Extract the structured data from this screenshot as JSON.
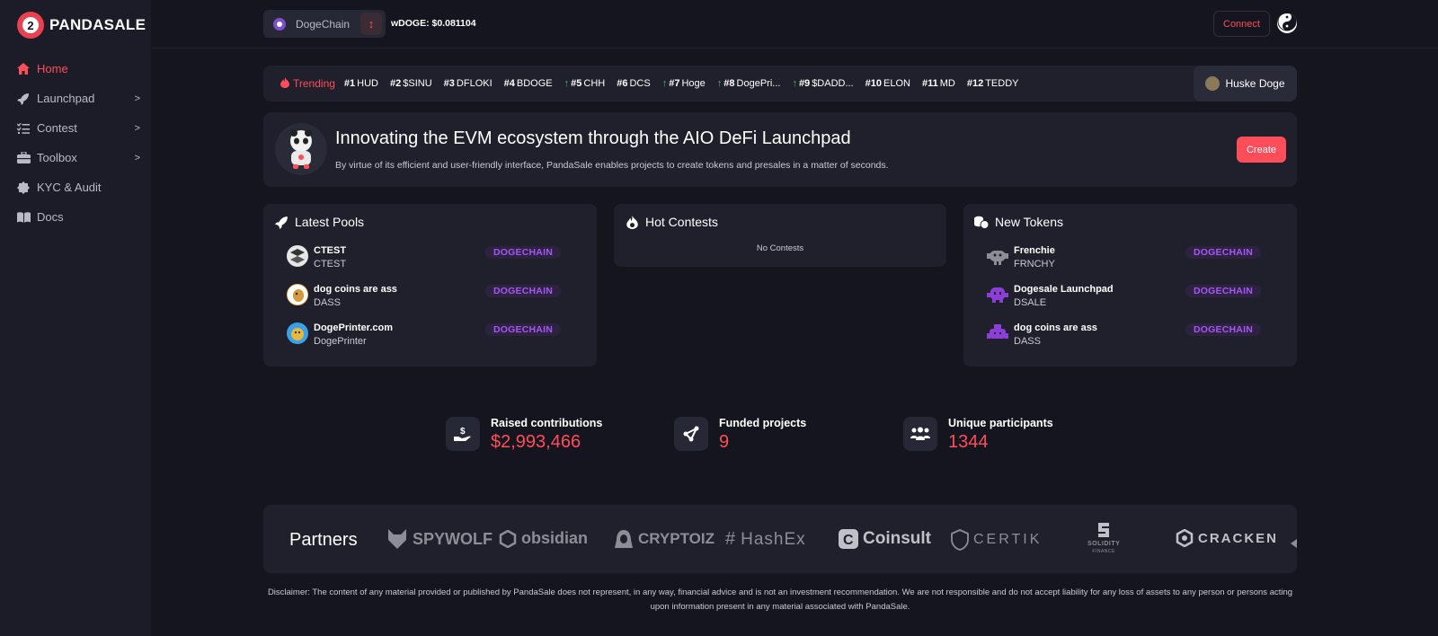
{
  "brand": {
    "name": "PANDASALE"
  },
  "sidebar": {
    "items": [
      {
        "label": "Home",
        "icon": "home-icon",
        "active": true,
        "chevron": false
      },
      {
        "label": "Launchpad",
        "icon": "rocket-icon",
        "active": false,
        "chevron": true
      },
      {
        "label": "Contest",
        "icon": "list-check-icon",
        "active": false,
        "chevron": true
      },
      {
        "label": "Toolbox",
        "icon": "toolbox-icon",
        "active": false,
        "chevron": true
      },
      {
        "label": "KYC & Audit",
        "icon": "badge-icon",
        "active": false,
        "chevron": false
      },
      {
        "label": "Docs",
        "icon": "book-icon",
        "active": false,
        "chevron": false
      }
    ],
    "chevron_glyph": ">"
  },
  "topbar": {
    "chain": "DogeChain",
    "price": "wDOGE: $0.081104",
    "connect_label": "Connect"
  },
  "trending": {
    "label": "Trending",
    "items": [
      {
        "rank": "#1",
        "name": "HUD",
        "up": false
      },
      {
        "rank": "#2",
        "name": "$SINU",
        "up": false
      },
      {
        "rank": "#3",
        "name": "DFLOKI",
        "up": false
      },
      {
        "rank": "#4",
        "name": "BDOGE",
        "up": false
      },
      {
        "rank": "#5",
        "name": "CHH",
        "up": true
      },
      {
        "rank": "#6",
        "name": "DCS",
        "up": false
      },
      {
        "rank": "#7",
        "name": "Hoge",
        "up": true
      },
      {
        "rank": "#8",
        "name": "DogePri...",
        "up": true
      },
      {
        "rank": "#9",
        "name": "$DADD...",
        "up": true
      },
      {
        "rank": "#10",
        "name": "ELON",
        "up": false
      },
      {
        "rank": "#11",
        "name": "MD",
        "up": false
      },
      {
        "rank": "#12",
        "name": "TEDDY",
        "up": false
      }
    ],
    "user": "Huske Doge"
  },
  "hero": {
    "title": "Innovating the EVM ecosystem through the AIO DeFi Launchpad",
    "subtitle": "By virtue of its efficient and user-friendly interface, PandaSale enables projects to create tokens and presales in a matter of seconds.",
    "create_label": "Create"
  },
  "latest_pools": {
    "title": "Latest Pools",
    "rows": [
      {
        "name": "CTEST",
        "symbol": "CTEST",
        "badge": "DOGECHAIN",
        "avatar_color": "#e6e6e6"
      },
      {
        "name": "dog coins are ass",
        "symbol": "DASS",
        "badge": "DOGECHAIN",
        "avatar_color": "#f2c572"
      },
      {
        "name": "DogePrinter.com",
        "symbol": "DogePrinter",
        "badge": "DOGECHAIN",
        "avatar_color": "#e9b83a"
      }
    ]
  },
  "hot_contests": {
    "title": "Hot Contests",
    "empty": "No Contests"
  },
  "new_tokens": {
    "title": "New Tokens",
    "rows": [
      {
        "name": "Frenchie",
        "symbol": "FRNCHY",
        "badge": "DOGECHAIN",
        "avatar_color": "#8c8d96"
      },
      {
        "name": "Dogesale Launchpad",
        "symbol": "DSALE",
        "badge": "DOGECHAIN",
        "avatar_color": "#8b3fd6"
      },
      {
        "name": "dog coins are ass",
        "symbol": "DASS",
        "badge": "DOGECHAIN",
        "avatar_color": "#8b3fd6"
      }
    ]
  },
  "stats": [
    {
      "label": "Raised contributions",
      "value": "$2,993,466",
      "icon": "hand-dollar-icon"
    },
    {
      "label": "Funded projects",
      "value": "9",
      "icon": "share-nodes-icon"
    },
    {
      "label": "Unique participants",
      "value": "1344",
      "icon": "users-icon"
    }
  ],
  "partners": {
    "title": "Partners",
    "logos": [
      "SPYWOLF",
      "obsidian",
      "CRYPTOIZ",
      "HashEx",
      "Coinsult",
      "CERTIK",
      "SOLIDITY",
      "FINANCE",
      "CRACKEN"
    ]
  },
  "disclaimer": "Disclaimer: The content of any material provided or published by PandaSale does not represent, in any way, financial advice and is not an investment recommendation. We are not responsible and do not accept liability for any loss of assets to any person or persons acting upon information present in any material associated with PandaSale.",
  "colors": {
    "accent": "#ff4d5a",
    "badge_text": "#a855f7",
    "badge_bg": "#2d2340",
    "panel": "#1f202c",
    "background": "#14151f",
    "up_arrow": "#34c759"
  }
}
